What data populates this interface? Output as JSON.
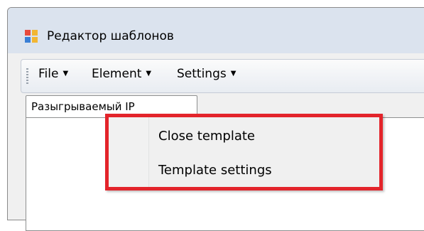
{
  "window": {
    "title": "Редактор шаблонов",
    "icon": "app-window-icon"
  },
  "menubar": {
    "items": [
      {
        "label": "File",
        "icon": "chevron-down-icon"
      },
      {
        "label": "Element",
        "icon": "chevron-down-icon"
      },
      {
        "label": "Settings",
        "icon": "chevron-down-icon"
      }
    ]
  },
  "tab": {
    "label": "Разыгрываемый IP"
  },
  "context_menu": {
    "items": [
      {
        "label": "Close template"
      },
      {
        "label": "Template settings"
      }
    ],
    "highlight_color": "#e3242b"
  }
}
